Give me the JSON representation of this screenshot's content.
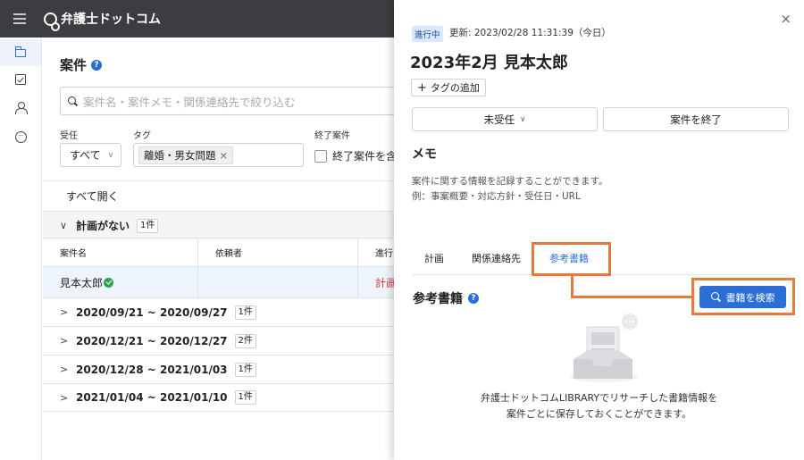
{
  "app": {
    "logo_text": "弁護士ドットコム"
  },
  "sidebar": {
    "items": [
      {
        "name": "cases",
        "icon": "folder-icon",
        "active": true
      },
      {
        "name": "tasks",
        "icon": "checkbox-icon",
        "active": false
      },
      {
        "name": "contacts",
        "icon": "person-icon",
        "active": false
      },
      {
        "name": "chat",
        "icon": "chat-bubble-icon",
        "active": false
      }
    ]
  },
  "main": {
    "title": "案件",
    "search_placeholder": "案件名・案件メモ・関係連絡先で絞り込む",
    "filters": {
      "receipt_label": "受任",
      "receipt_value": "すべて",
      "tag_label": "タグ",
      "tag_chip": "離婚・男女問題",
      "tag_chip_remove": "×",
      "ended_label": "終了案件",
      "ended_checkbox_label": "終了案件を含む"
    },
    "expand_all": "すべて開く",
    "groups": [
      {
        "label": "計画がない",
        "count": "1件",
        "expanded": true
      },
      {
        "label": "2020/09/21 ~ 2020/09/27",
        "count": "1件",
        "expanded": false
      },
      {
        "label": "2020/12/21 ~ 2020/12/27",
        "count": "2件",
        "expanded": false
      },
      {
        "label": "2020/12/28 ~ 2021/01/03",
        "count": "1件",
        "expanded": false
      },
      {
        "label": "2021/01/04 ~ 2021/01/10",
        "count": "1件",
        "expanded": false
      }
    ],
    "table": {
      "headers": [
        "案件名",
        "依頼者",
        "進行中の計"
      ],
      "rows": [
        {
          "case_name": "見本太郎",
          "client": "",
          "plan": "計画なし"
        }
      ]
    }
  },
  "panel": {
    "close": "×",
    "status": "進行中",
    "updated": "更新: 2023/02/28  11:31:39（今日）",
    "title": "2023年2月 見本太郎",
    "add_tag": "タグの追加",
    "receipt_dropdown": "未受任",
    "end_case_button": "案件を終了",
    "memo_heading": "メモ",
    "memo_line1": "案件に関する情報を記録することができます。",
    "memo_line2": "例：事案概要・対応方針・受任日・URL",
    "tabs": [
      "計画",
      "関係連絡先",
      "参考書籍"
    ],
    "active_tab": 2,
    "ref_heading": "参考書籍",
    "search_books_button": "書籍を検索",
    "empty_line1": "弁護士ドットコムLIBRARYでリサーチした書籍情報を",
    "empty_line2": "案件ごとに保存しておくことができます。"
  },
  "colors": {
    "accent": "#2b6fd6",
    "highlight": "#e8783c",
    "warning_text": "#d9373d",
    "ok": "#2ea44f"
  }
}
